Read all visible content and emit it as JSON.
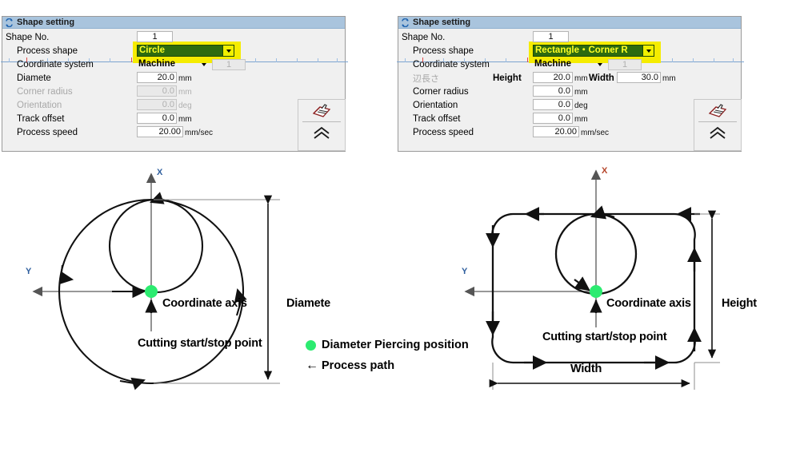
{
  "panels": [
    {
      "id": "circle",
      "title": "Shape setting",
      "title_icon": "shape-setting-icon",
      "rows": {
        "shape_no_label": "Shape No.",
        "shape_no_value": "1",
        "process_shape_label": "Process shape",
        "process_shape_value": "Circle",
        "coordinate_system_label": "Coordinate system",
        "coordinate_system_value": "Machine",
        "coordinate_system_index": "1",
        "size_label": "Diamete",
        "size_value": "20.0",
        "size_unit": "mm",
        "corner_radius_label": "Corner radius",
        "corner_radius_value": "0.0",
        "corner_radius_unit": "mm",
        "orientation_label": "Orientation",
        "orientation_value": "0.0",
        "orientation_unit": "deg",
        "track_offset_label": "Track offset",
        "track_offset_value": "0.0",
        "track_offset_unit": "mm",
        "process_speed_label": "Process speed",
        "process_speed_value": "20.00",
        "process_speed_unit": "mm/sec"
      },
      "buttons": {
        "help_icon": "hand-book-icon",
        "collapse_icon": "double-chevron-up-icon"
      }
    },
    {
      "id": "rectangle",
      "title": "Shape setting",
      "title_icon": "shape-setting-icon",
      "rows": {
        "shape_no_label": "Shape No.",
        "shape_no_value": "1",
        "process_shape_label": "Process shape",
        "process_shape_value": "Rectangle・Corner R",
        "coordinate_system_label": "Coordinate system",
        "coordinate_system_value": "Machine",
        "coordinate_system_index": "1",
        "size_label": "辺長さ",
        "height_label": "Height",
        "height_value": "20.0",
        "height_unit": "mm",
        "width_label": "Width",
        "width_value": "30.0",
        "width_unit": "mm",
        "corner_radius_label": "Corner radius",
        "corner_radius_value": "0.0",
        "corner_radius_unit": "mm",
        "orientation_label": "Orientation",
        "orientation_value": "0.0",
        "orientation_unit": "deg",
        "track_offset_label": "Track offset",
        "track_offset_value": "0.0",
        "track_offset_unit": "mm",
        "process_speed_label": "Process speed",
        "process_speed_value": "20.00",
        "process_speed_unit": "mm/sec"
      },
      "buttons": {
        "help_icon": "hand-book-icon",
        "collapse_icon": "double-chevron-up-icon"
      }
    }
  ],
  "diagram_circle": {
    "axis_x": "X",
    "axis_y": "Y",
    "coordinate_axis_label": "Coordinate axis",
    "cutting_point_label": "Cutting start/stop point",
    "dimension_label": "Diamete"
  },
  "diagram_rectangle": {
    "axis_x": "X",
    "axis_y": "Y",
    "coordinate_axis_label": "Coordinate axis",
    "cutting_point_label": "Cutting start/stop point",
    "height_label": "Height",
    "width_label": "Width"
  },
  "legend": {
    "dot_label": "Diameter Piercing position",
    "arrow_label": "Process path",
    "arrow_glyph": "←"
  },
  "colors": {
    "titlebar": "#a9c4dd",
    "panel_bg": "#f0f0f0",
    "highlight_yellow": "#f5ec00",
    "combo_selected_bg": "#2d6b0f",
    "combo_selected_text": "#ffff22",
    "piercing_green": "#2ceb70",
    "stroke": "#1a1a1a"
  }
}
